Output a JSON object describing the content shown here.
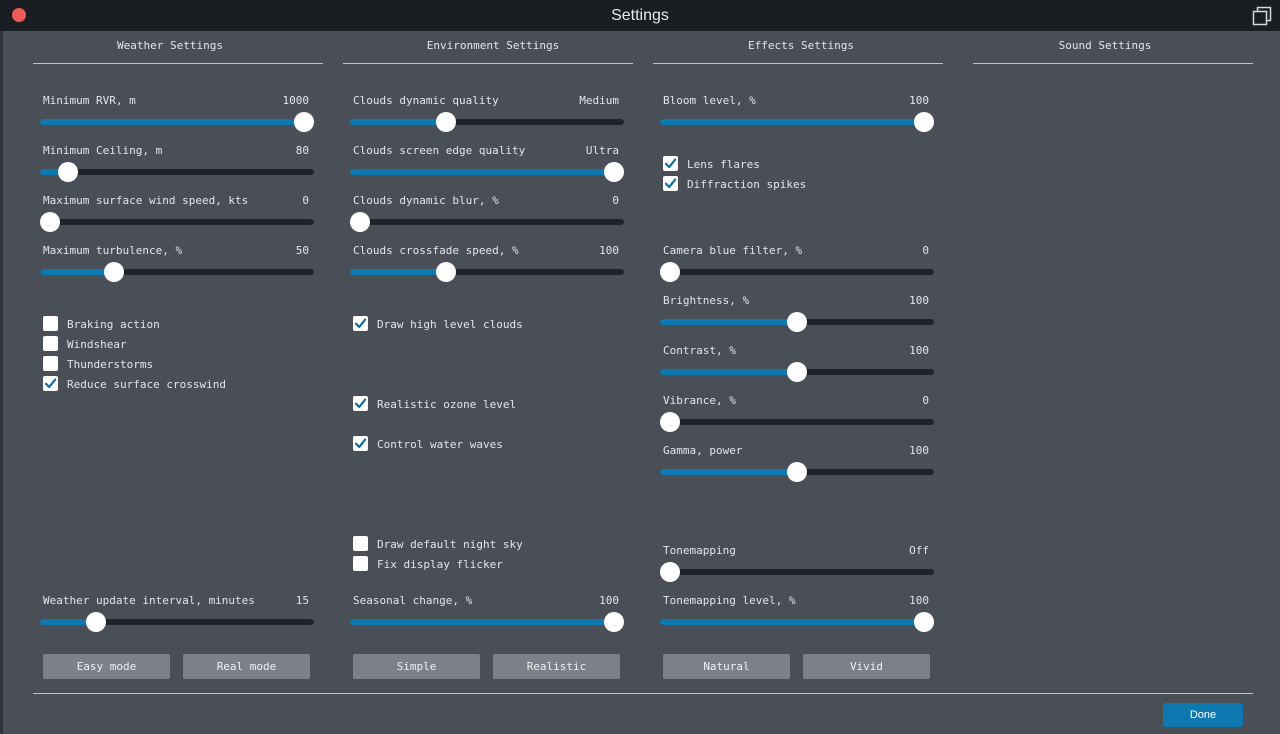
{
  "window": {
    "title": "Settings"
  },
  "sections": {
    "weather": "Weather Settings",
    "environment": "Environment Settings",
    "effects": "Effects Settings",
    "sound": "Sound Settings"
  },
  "weather": {
    "min_rvr": {
      "label": "Minimum RVR, m",
      "value": "1000",
      "level": 1.0
    },
    "min_ceiling": {
      "label": "Minimum Ceiling, m",
      "value": "80",
      "level": 0.07
    },
    "wind": {
      "label": "Maximum surface wind speed, kts",
      "value": "0",
      "level": 0.0
    },
    "turbulence": {
      "label": "Maximum turbulence, %",
      "value": "50",
      "level": 0.25
    },
    "braking": {
      "label": "Braking action",
      "checked": false
    },
    "windshear": {
      "label": "Windshear",
      "checked": false
    },
    "thunderstorms": {
      "label": "Thunderstorms",
      "checked": false
    },
    "crosswind": {
      "label": "Reduce surface crosswind",
      "checked": true
    },
    "update_interval": {
      "label": "Weather update interval, minutes",
      "value": "15",
      "level": 0.18
    },
    "easy_mode": "Easy mode",
    "real_mode": "Real mode"
  },
  "environment": {
    "clouds_quality": {
      "label": "Clouds dynamic quality",
      "value": "Medium",
      "level": 0.34
    },
    "clouds_edge": {
      "label": "Clouds screen edge quality",
      "value": "Ultra",
      "level": 1.0
    },
    "clouds_blur": {
      "label": "Clouds dynamic blur, %",
      "value": "0",
      "level": 0.0
    },
    "clouds_crossfade": {
      "label": "Clouds crossfade speed, %",
      "value": "100",
      "level": 0.34
    },
    "high_clouds": {
      "label": "Draw high level clouds",
      "checked": true
    },
    "ozone": {
      "label": "Realistic ozone level",
      "checked": true
    },
    "water_waves": {
      "label": "Control water waves",
      "checked": true
    },
    "night_sky": {
      "label": "Draw default night sky",
      "checked": false
    },
    "flicker": {
      "label": "Fix display flicker",
      "checked": false
    },
    "seasonal": {
      "label": "Seasonal change, %",
      "value": "100",
      "level": 1.0
    },
    "simple": "Simple",
    "realistic": "Realistic"
  },
  "effects": {
    "bloom": {
      "label": "Bloom level, %",
      "value": "100",
      "level": 1.0
    },
    "lens_flares": {
      "label": "Lens flares",
      "checked": true
    },
    "diffraction": {
      "label": "Diffraction spikes",
      "checked": true
    },
    "blue_filter": {
      "label": "Camera blue filter, %",
      "value": "0",
      "level": 0.0
    },
    "brightness": {
      "label": "Brightness, %",
      "value": "100",
      "level": 0.5
    },
    "contrast": {
      "label": "Contrast, %",
      "value": "100",
      "level": 0.5
    },
    "vibrance": {
      "label": "Vibrance, %",
      "value": "0",
      "level": 0.0
    },
    "gamma": {
      "label": "Gamma, power",
      "value": "100",
      "level": 0.5
    },
    "tonemapping": {
      "label": "Tonemapping",
      "value": "Off",
      "level": 0.0
    },
    "tonemapping_level": {
      "label": "Tonemapping level, %",
      "value": "100",
      "level": 1.0
    },
    "natural": "Natural",
    "vivid": "Vivid"
  },
  "footer": {
    "done": "Done"
  },
  "colors": {
    "accent": "#0e78b1",
    "window_bg": "#4a4f57",
    "titlebar": "#1a1d21",
    "close": "#ec5b55"
  }
}
